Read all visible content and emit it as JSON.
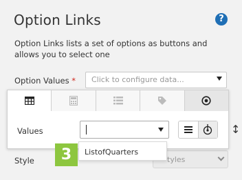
{
  "header": {
    "title": "Option Links",
    "help_glyph": "?"
  },
  "description": "Option Links lists a set of options as buttons and allows you to select one",
  "option_values": {
    "label": "Option Values",
    "required_mark": "*",
    "placeholder": "Click to configure data..."
  },
  "popup": {
    "tabs": [
      {
        "icon": "table-icon",
        "active": false
      },
      {
        "icon": "calculator-icon",
        "active": false
      },
      {
        "icon": "list-icon",
        "active": false
      },
      {
        "icon": "tag-icon",
        "active": false
      },
      {
        "icon": "target-icon",
        "active": true
      }
    ],
    "values_label": "Values",
    "values_input": ""
  },
  "dropdown": {
    "items": [
      "ListofQuarters"
    ]
  },
  "style_field": {
    "label": "Style",
    "value": "tyles"
  },
  "step_badge": "3",
  "colors": {
    "accent_blue": "#1f6fb5",
    "required_red": "#d0271d",
    "badge_green": "#8dc63f"
  }
}
